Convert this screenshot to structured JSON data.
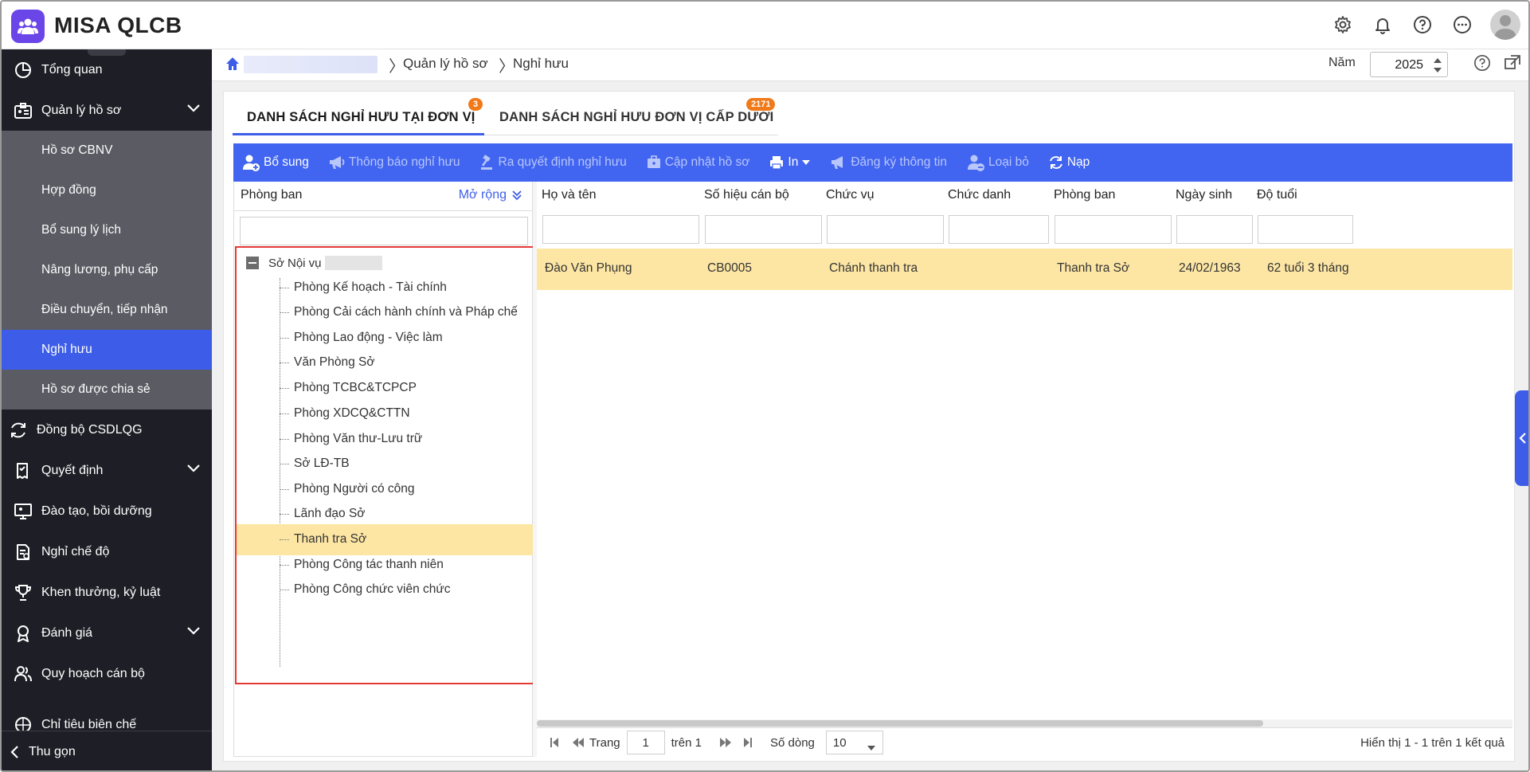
{
  "app": {
    "brand": "MISA QLCB"
  },
  "topbar": {
    "icons": [
      "gear-icon",
      "bell-icon",
      "help-icon",
      "more-icon",
      "avatar"
    ]
  },
  "sidebar": {
    "items": [
      {
        "label": "Tổng quan",
        "icon": "pie-chart-icon"
      },
      {
        "label": "Quản lý hồ sơ",
        "icon": "id-card-icon",
        "expanded": true,
        "children": [
          {
            "label": "Hồ sơ CBNV"
          },
          {
            "label": "Hợp đồng"
          },
          {
            "label": "Bổ sung lý lịch"
          },
          {
            "label": "Nâng lương, phụ cấp"
          },
          {
            "label": "Điều chuyển, tiếp nhận"
          },
          {
            "label": "Nghỉ hưu",
            "active": true
          },
          {
            "label": "Hồ sơ được chia sẻ"
          }
        ]
      },
      {
        "label": "Đồng bộ CSDLQG",
        "icon": "sync-icon"
      },
      {
        "label": "Quyết định",
        "icon": "document-icon",
        "has_children": true
      },
      {
        "label": "Đào tạo, bồi dưỡng",
        "icon": "monitor-icon"
      },
      {
        "label": "Nghỉ chế độ",
        "icon": "file-icon"
      },
      {
        "label": "Khen thưởng, kỷ luật",
        "icon": "trophy-icon"
      },
      {
        "label": "Đánh giá",
        "icon": "award-icon",
        "has_children": true
      },
      {
        "label": "Quy hoạch cán bộ",
        "icon": "users-icon"
      },
      {
        "label": "Chỉ tiêu biên chế",
        "icon": "target-icon"
      }
    ],
    "footer": "Thu gọn"
  },
  "breadcrumb": {
    "items": [
      "Quản lý hồ sơ",
      "Nghỉ hưu"
    ],
    "year_label": "Năm",
    "year_value": "2025"
  },
  "tabs": [
    {
      "label": "DANH SÁCH NGHỈ HƯU TẠI ĐƠN VỊ",
      "badge": "3",
      "active": true
    },
    {
      "label": "DANH SÁCH NGHỈ HƯU ĐƠN VỊ CẤP DƯỚI",
      "badge": "2171",
      "active": false
    }
  ],
  "toolbar": {
    "add": "Bổ sung",
    "notify": "Thông báo nghỉ hưu",
    "decide": "Ra quyết định nghỉ hưu",
    "update": "Cập nhật hồ sơ",
    "print": "In",
    "register": "Đăng ký thông tin",
    "remove": "Loại bỏ",
    "reload": "Nạp"
  },
  "tree": {
    "header": "Phòng ban",
    "expand_label": "Mở rộng",
    "root": "Sở Nội vụ",
    "nodes": [
      "Phòng Kế hoạch - Tài chính",
      "Phòng Cải cách hành chính và Pháp chế",
      "Phòng Lao động - Việc làm",
      "Văn Phòng Sở",
      "Phòng TCBC&TCPCP",
      "Phòng XDCQ&CTTN",
      "Phòng Văn thư-Lưu trữ",
      "Sở LĐ-TB",
      "Phòng Người có công",
      "Lãnh đạo Sở",
      "Thanh tra Sở",
      "Phòng Công tác thanh niên",
      "Phòng Công chức viên chức"
    ],
    "selected": "Thanh tra Sở"
  },
  "grid": {
    "columns": [
      "Họ và tên",
      "Số hiệu cán bộ",
      "Chức vụ",
      "Chức danh",
      "Phòng ban",
      "Ngày sinh",
      "Độ tuổi"
    ],
    "rows": [
      {
        "name": "Đào Văn Phụng",
        "code": "CB0005",
        "position": "Chánh thanh tra",
        "title": "",
        "dept": "Thanh tra Sở",
        "dob": "24/02/1963",
        "age": "62 tuổi 3 tháng"
      }
    ]
  },
  "pager": {
    "page_label": "Trang",
    "page_value": "1",
    "of_label": "trên 1",
    "rows_label": "Số dòng",
    "rows_value": "10",
    "summary": "Hiển thị 1 - 1 trên 1 kết quả"
  },
  "colors": {
    "primary": "#4165f0",
    "sidebar": "#1e1f26",
    "selected_row": "#fde6a4",
    "badge": "#f07a1a",
    "highlight_border": "#e53935"
  }
}
